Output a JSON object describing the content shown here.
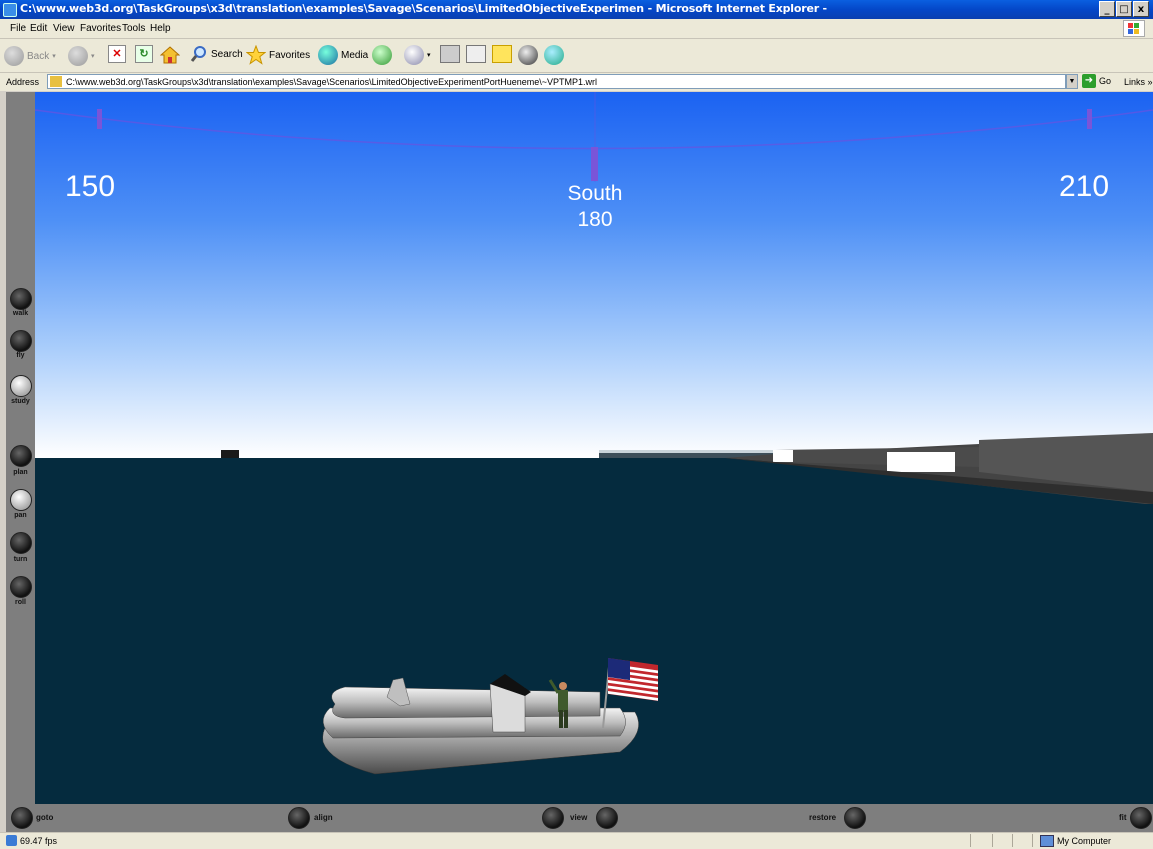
{
  "window": {
    "title": "C:\\www.web3d.org\\TaskGroups\\x3d\\translation\\examples\\Savage\\Scenarios\\LimitedObjectiveExperimen - Microsoft Internet Explorer -",
    "buttons": {
      "minimize": "_",
      "maximize": "□",
      "close": "x"
    }
  },
  "menu": [
    "File",
    "Edit",
    "View",
    "Favorites",
    "Tools",
    "Help"
  ],
  "toolbar": {
    "back": "Back",
    "search": "Search",
    "favorites": "Favorites",
    "media": "Media"
  },
  "address": {
    "label": "Address",
    "value": "C:\\www.web3d.org\\TaskGroups\\x3d\\translation\\examples\\Savage\\Scenarios\\LimitedObjectiveExperimentPortHueneme\\~VPTMP1.wrl",
    "go": "Go",
    "links": "Links"
  },
  "compass": {
    "left": "150",
    "center_label": "South",
    "center_value": "180",
    "right": "210"
  },
  "nav": {
    "left": [
      {
        "label": "walk",
        "icon": "walk-icon"
      },
      {
        "label": "fly",
        "icon": "fly-icon"
      },
      {
        "label": "study",
        "icon": "study-icon"
      },
      {
        "label": "plan",
        "icon": "plan-icon"
      },
      {
        "label": "pan",
        "icon": "pan-icon"
      },
      {
        "label": "turn",
        "icon": "turn-icon"
      },
      {
        "label": "roll",
        "icon": "roll-icon"
      }
    ],
    "bottom": {
      "goto": "goto",
      "align": "align",
      "view": "view",
      "restore": "restore",
      "fit": "fit"
    }
  },
  "status": {
    "fps": "69.47 fps",
    "zone": "My Computer"
  },
  "colors": {
    "sky_top": "#1b62f2",
    "sky_bottom": "#ffffff",
    "water": "#052b3e",
    "compass_line": "#5a3fd8"
  }
}
